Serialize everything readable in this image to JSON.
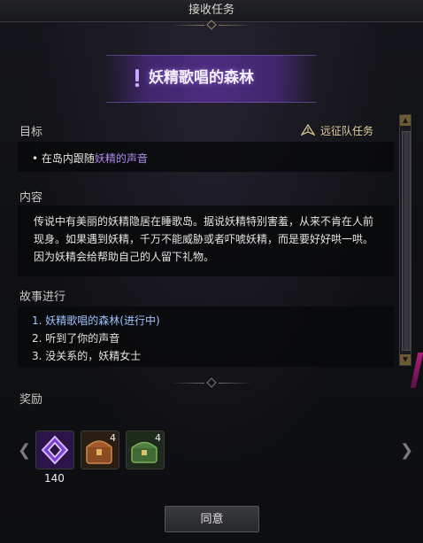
{
  "window": {
    "title": "接收任务"
  },
  "quest": {
    "title": "妖精歌唱的森林"
  },
  "objective": {
    "heading": "目标",
    "prefix": "在岛内跟随",
    "highlight": "妖精的声音",
    "tag": "远征队任务",
    "tag_icon": "expedition-icon"
  },
  "content": {
    "heading": "内容",
    "text": "传说中有美丽的妖精隐居在睡歌岛。据说妖精特别害羞，从来不肯在人前现身。如果遇到妖精，千万不能威胁或者吓唬妖精，而是要好好哄一哄。因为妖精会给帮助自己的人留下礼物。"
  },
  "story": {
    "heading": "故事进行",
    "items": [
      {
        "label": "1. 妖精歌唱的森林(进行中)",
        "active": true
      },
      {
        "label": "2. 听到了你的声音",
        "active": false
      },
      {
        "label": "3. 没关系的，妖精女士",
        "active": false
      }
    ]
  },
  "rewards": {
    "heading": "奖励",
    "items": [
      {
        "icon": "purple-crystal-icon",
        "count": "140"
      },
      {
        "icon": "treasure-chest-icon",
        "count": "4"
      },
      {
        "icon": "green-chest-icon",
        "count": "4"
      }
    ]
  },
  "actions": {
    "confirm": "同意"
  },
  "colors": {
    "accent_purple": "#b08cf0",
    "active_blue": "#9fc3ff",
    "gold": "#e0cf9a"
  }
}
